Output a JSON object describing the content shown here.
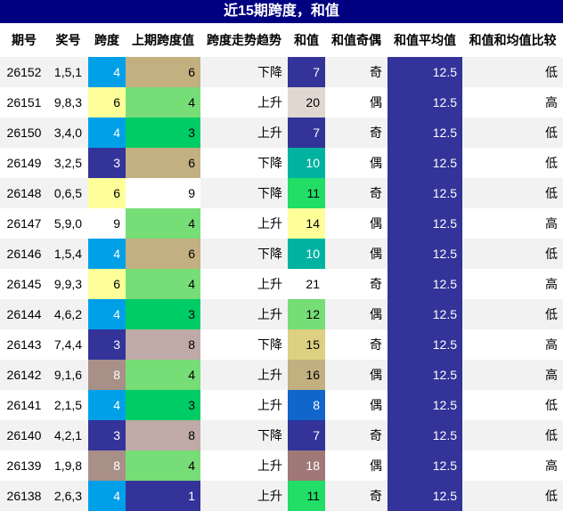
{
  "title": "近15期跨度，和值",
  "headers": [
    "期号",
    "奖号",
    "跨度",
    "上期跨度值",
    "跨度走势趋势",
    "和值",
    "和值奇偶",
    "和值平均值",
    "和值和均值比较"
  ],
  "palette": {
    "span": {
      "3": "#333399",
      "4": "#00a0e9",
      "6": "#ffff99",
      "8": "#a89088",
      "9": "#ffffff"
    },
    "prev_span": {
      "1": "#333399",
      "3": "#00cc66",
      "4": "#77dd77",
      "6": "#c2b080",
      "8": "#c0aaa8",
      "9": "#ffffff"
    },
    "sum": {
      "7": "#333399",
      "8": "#1166cc",
      "10": "#00b3a0",
      "11": "#22dd66",
      "12": "#77dd77",
      "14": "#ffff99",
      "15": "#ddd080",
      "16": "#c2b080",
      "18": "#a07878",
      "20": "#e0d8d0",
      "21": "#ffffff"
    },
    "avg_bg": "#333399",
    "light_text": "#ffffff",
    "dark_text": "#000000"
  },
  "rows": [
    {
      "issue": "26152",
      "nums": "1,5,1",
      "span": "4",
      "prev_span": "6",
      "trend": "下降",
      "sum": "7",
      "parity": "奇",
      "avg": "12.5",
      "compare": "低"
    },
    {
      "issue": "26151",
      "nums": "9,8,3",
      "span": "6",
      "prev_span": "4",
      "trend": "上升",
      "sum": "20",
      "parity": "偶",
      "avg": "12.5",
      "compare": "高"
    },
    {
      "issue": "26150",
      "nums": "3,4,0",
      "span": "4",
      "prev_span": "3",
      "trend": "上升",
      "sum": "7",
      "parity": "奇",
      "avg": "12.5",
      "compare": "低"
    },
    {
      "issue": "26149",
      "nums": "3,2,5",
      "span": "3",
      "prev_span": "6",
      "trend": "下降",
      "sum": "10",
      "parity": "偶",
      "avg": "12.5",
      "compare": "低"
    },
    {
      "issue": "26148",
      "nums": "0,6,5",
      "span": "6",
      "prev_span": "9",
      "trend": "下降",
      "sum": "11",
      "parity": "奇",
      "avg": "12.5",
      "compare": "低"
    },
    {
      "issue": "26147",
      "nums": "5,9,0",
      "span": "9",
      "prev_span": "4",
      "trend": "上升",
      "sum": "14",
      "parity": "偶",
      "avg": "12.5",
      "compare": "高"
    },
    {
      "issue": "26146",
      "nums": "1,5,4",
      "span": "4",
      "prev_span": "6",
      "trend": "下降",
      "sum": "10",
      "parity": "偶",
      "avg": "12.5",
      "compare": "低"
    },
    {
      "issue": "26145",
      "nums": "9,9,3",
      "span": "6",
      "prev_span": "4",
      "trend": "上升",
      "sum": "21",
      "parity": "奇",
      "avg": "12.5",
      "compare": "高"
    },
    {
      "issue": "26144",
      "nums": "4,6,2",
      "span": "4",
      "prev_span": "3",
      "trend": "上升",
      "sum": "12",
      "parity": "偶",
      "avg": "12.5",
      "compare": "低"
    },
    {
      "issue": "26143",
      "nums": "7,4,4",
      "span": "3",
      "prev_span": "8",
      "trend": "下降",
      "sum": "15",
      "parity": "奇",
      "avg": "12.5",
      "compare": "高"
    },
    {
      "issue": "26142",
      "nums": "9,1,6",
      "span": "8",
      "prev_span": "4",
      "trend": "上升",
      "sum": "16",
      "parity": "偶",
      "avg": "12.5",
      "compare": "高"
    },
    {
      "issue": "26141",
      "nums": "2,1,5",
      "span": "4",
      "prev_span": "3",
      "trend": "上升",
      "sum": "8",
      "parity": "偶",
      "avg": "12.5",
      "compare": "低"
    },
    {
      "issue": "26140",
      "nums": "4,2,1",
      "span": "3",
      "prev_span": "8",
      "trend": "下降",
      "sum": "7",
      "parity": "奇",
      "avg": "12.5",
      "compare": "低"
    },
    {
      "issue": "26139",
      "nums": "1,9,8",
      "span": "8",
      "prev_span": "4",
      "trend": "上升",
      "sum": "18",
      "parity": "偶",
      "avg": "12.5",
      "compare": "高"
    },
    {
      "issue": "26138",
      "nums": "2,6,3",
      "span": "4",
      "prev_span": "1",
      "trend": "上升",
      "sum": "11",
      "parity": "奇",
      "avg": "12.5",
      "compare": "低"
    }
  ]
}
